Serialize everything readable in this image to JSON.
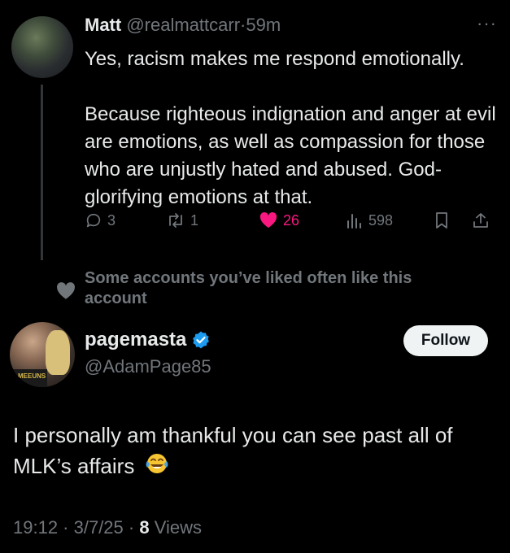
{
  "tweet": {
    "author_name": "Matt",
    "author_handle": "@realmattcarr",
    "separator": "·",
    "time_ago": "59m",
    "more": "···",
    "paragraphs": [
      "Yes, racism makes me respond emotionally.",
      "Because righteous indignation and anger at evil are emotions, as well as compassion for those who are unjustly hated and abused. God-glorifying emotions at that."
    ],
    "actions": {
      "replies": "3",
      "reposts": "1",
      "likes": "26",
      "views": "598"
    }
  },
  "liked_note": "Some accounts you’ve liked often like this account",
  "reply": {
    "author_name": "pagemasta",
    "author_handle": "@AdamPage85",
    "verified": true,
    "follow_label": "Follow",
    "avatar_shirt_text": "MEEUNS",
    "text": "I personally am thankful you can see past all of MLK’s affairs",
    "emoji": "face-with-tears-of-joy",
    "timestamp": "19:12 · 3/7/25 · ",
    "views_count": "8",
    "views_label": " Views"
  },
  "colors": {
    "background": "#000000",
    "text": "#e7e9ea",
    "muted": "#71767b",
    "like": "#f91880",
    "verified": "#1d9bf0"
  }
}
